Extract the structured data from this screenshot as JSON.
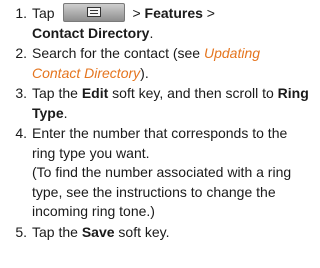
{
  "steps": [
    {
      "num": "1.",
      "sep1": " > ",
      "b1": "Features",
      "sep2": " >",
      "b2": "Contact Directory",
      "end": "."
    },
    {
      "num": "2.",
      "pre": "Search for the contact (see ",
      "link": "Updating Contact Directory",
      "post": ")."
    },
    {
      "num": "3.",
      "pre": "Tap the ",
      "b1": "Edit",
      "mid": " soft key, and then scroll to ",
      "b2": "Ring Type",
      "end": "."
    },
    {
      "num": "4.",
      "text": "Enter the number that corresponds to the ring type you want.",
      "note": "(To find the number associated with a ring type, see the instructions to change the incoming ring tone.)"
    },
    {
      "num": "5.",
      "pre": "Tap the ",
      "b1": "Save",
      "post": " soft key."
    }
  ],
  "icons": {
    "menu_key": "menu-key-icon"
  }
}
